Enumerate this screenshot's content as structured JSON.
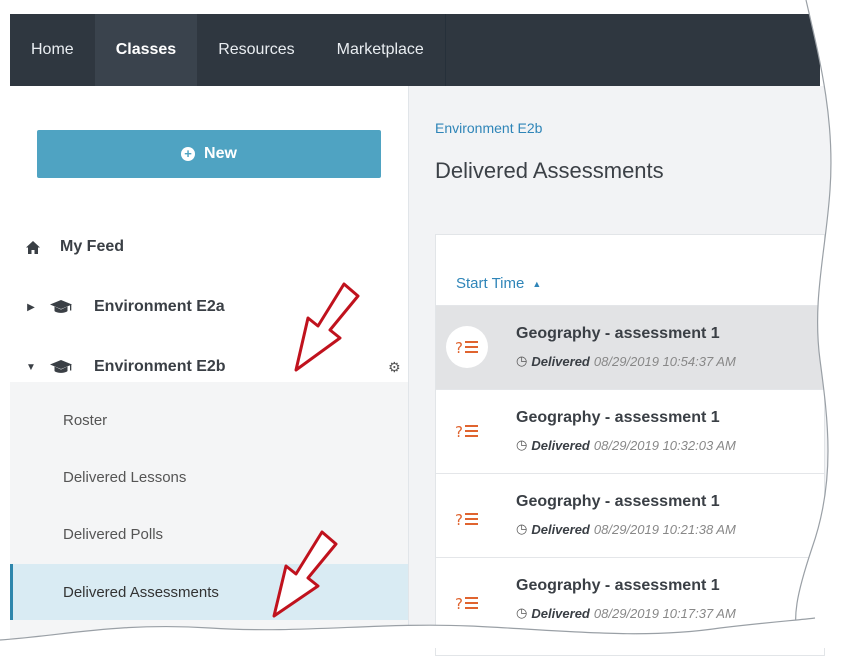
{
  "nav": {
    "tabs": [
      {
        "label": "Home",
        "active": false
      },
      {
        "label": "Classes",
        "active": true
      },
      {
        "label": "Resources",
        "active": false
      },
      {
        "label": "Marketplace",
        "active": false
      }
    ]
  },
  "sidebar": {
    "new_button_label": "New",
    "tree": [
      {
        "label": "My Feed",
        "icon": "home-icon"
      },
      {
        "label": "Environment E2a",
        "icon": "graduation-cap-icon",
        "expanded": false
      },
      {
        "label": "Environment E2b",
        "icon": "graduation-cap-icon",
        "expanded": true
      }
    ],
    "subitems": [
      {
        "label": "Roster",
        "active": false
      },
      {
        "label": "Delivered Lessons",
        "active": false
      },
      {
        "label": "Delivered Polls",
        "active": false
      },
      {
        "label": "Delivered Assessments",
        "active": true
      }
    ]
  },
  "main": {
    "breadcrumb": "Environment E2b",
    "title": "Delivered Assessments",
    "sort_label": "Start Time",
    "rows": [
      {
        "title": "Geography - assessment 1",
        "status": "Delivered",
        "time": "08/29/2019 10:54:37 AM",
        "selected": true
      },
      {
        "title": "Geography - assessment 1",
        "status": "Delivered",
        "time": "08/29/2019 10:32:03 AM",
        "selected": false
      },
      {
        "title": "Geography - assessment 1",
        "status": "Delivered",
        "time": "08/29/2019 10:21:38 AM",
        "selected": false
      },
      {
        "title": "Geography - assessment 1",
        "status": "Delivered",
        "time": "08/29/2019 10:17:37 AM",
        "selected": false
      }
    ]
  },
  "colors": {
    "nav_bg": "#2f3740",
    "accent_button": "#4fa3c2",
    "link": "#2f85b8",
    "assessment_icon": "#e0642f",
    "annotation_arrow": "#c0121d"
  }
}
